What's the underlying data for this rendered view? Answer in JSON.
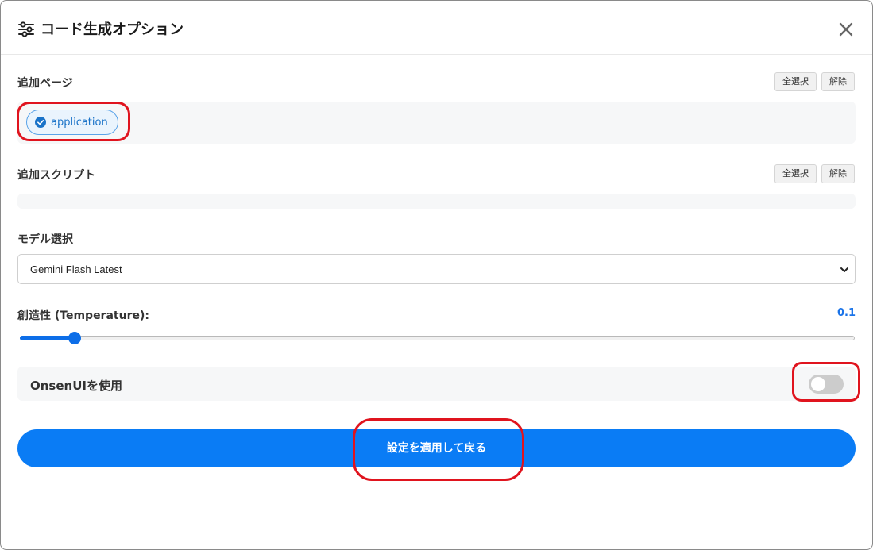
{
  "dialog": {
    "title": "コード生成オプション",
    "icons": {
      "title": "sliders-icon",
      "close": "close-icon"
    }
  },
  "pages": {
    "label": "追加ページ",
    "select_all": "全選択",
    "clear": "解除",
    "chips": [
      {
        "label": "application",
        "checked": true,
        "icon": "check-circle-icon"
      }
    ]
  },
  "scripts": {
    "label": "追加スクリプト",
    "select_all": "全選択",
    "clear": "解除",
    "chips": []
  },
  "model": {
    "label": "モデル選択",
    "selected": "Gemini Flash Latest",
    "icon": "chevron-down-icon"
  },
  "temperature": {
    "label": "創造性 (Temperature):",
    "value": "0.1",
    "min": 0,
    "max": 1,
    "current": 0.1
  },
  "onsen": {
    "label": "OnsenUIを使用",
    "enabled": false
  },
  "apply_button": {
    "label": "設定を適用して戻る"
  },
  "colors": {
    "accent": "#0a7cf5",
    "annotation": "#e0141e",
    "chip_border": "#5aa3e8",
    "toggle_off": "#cccccc"
  }
}
